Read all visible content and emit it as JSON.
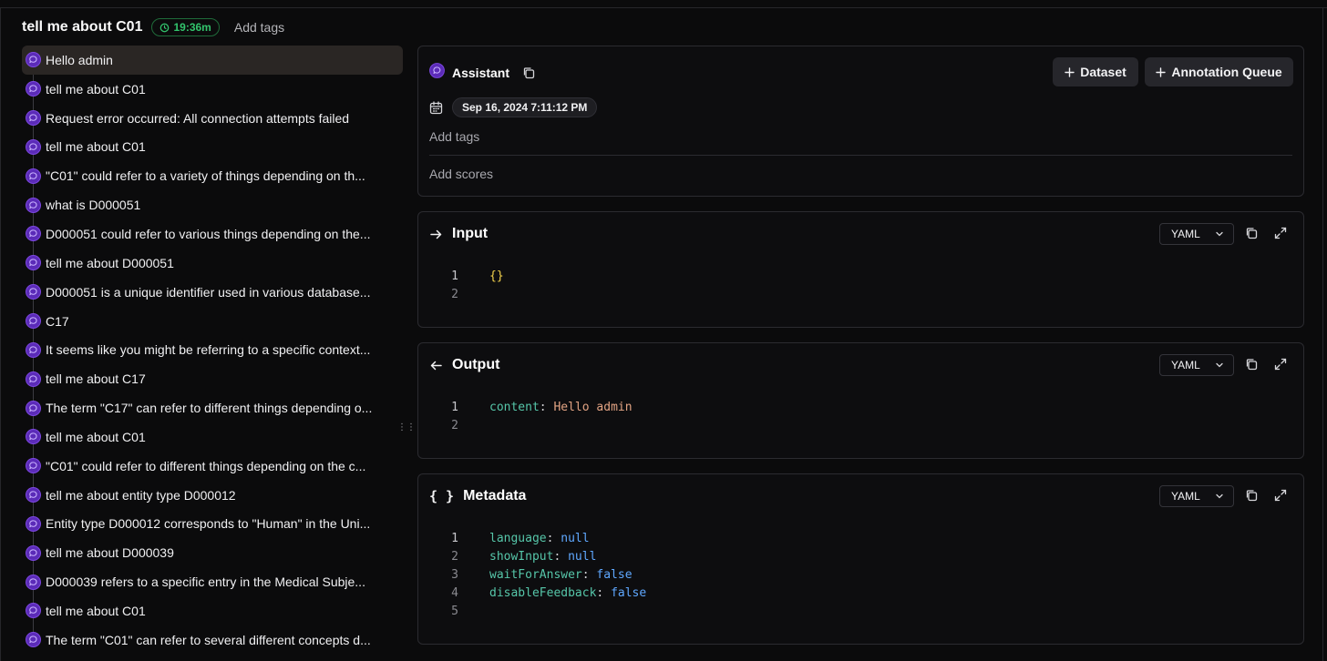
{
  "header": {
    "title": "tell me about C01",
    "timer": "19:36m",
    "add_tags": "Add tags"
  },
  "trace_list": [
    "Hello admin",
    "tell me about C01",
    "Request error occurred: All connection attempts failed",
    "tell me about C01",
    "\"C01\" could refer to a variety of things depending on th...",
    "what is D000051",
    "D000051 could refer to various things depending on the...",
    "tell me about D000051",
    "D000051 is a unique identifier used in various database...",
    "C17",
    "It seems like you might be referring to a specific context...",
    "tell me about C17",
    "The term \"C17\" can refer to different things depending o...",
    "tell me about C01",
    "\"C01\" could refer to different things depending on the c...",
    "tell me about entity type D000012",
    "Entity type D000012 corresponds to \"Human\" in the Uni...",
    "tell me about D000039",
    "D000039 refers to a specific entry in the Medical Subje...",
    "tell me about C01",
    "The term \"C01\" can refer to several different concepts d..."
  ],
  "detail": {
    "role": "Assistant",
    "dataset_button": "Dataset",
    "queue_button": "Annotation Queue",
    "date": "Sep 16, 2024 7:11:12 PM",
    "add_tags": "Add tags",
    "add_scores": "Add scores"
  },
  "input": {
    "title": "Input",
    "format": "YAML",
    "lines": [
      "1",
      "2"
    ],
    "code": "{}"
  },
  "output": {
    "title": "Output",
    "format": "YAML",
    "lines": [
      "1",
      "2"
    ],
    "key": "content",
    "value": "Hello admin"
  },
  "metadata": {
    "title": "Metadata",
    "format": "YAML",
    "lines": [
      "1",
      "2",
      "3",
      "4",
      "5"
    ],
    "entries": [
      {
        "key": "language",
        "value": "null"
      },
      {
        "key": "showInput",
        "value": "null"
      },
      {
        "key": "waitForAnswer",
        "value": "false"
      },
      {
        "key": "disableFeedback",
        "value": "false"
      }
    ]
  },
  "icons": {
    "timer": "clock-icon",
    "bubble": "chat-bubble-icon",
    "copy": "copy-icon",
    "calendar": "calendar-icon",
    "plus": "plus-icon",
    "input": "arrow-right-icon",
    "output": "arrow-left-icon",
    "metadata": "braces-icon",
    "expand": "expand-icon",
    "chevron": "chevron-down-icon",
    "drag": "drag-handle-icon"
  },
  "colors": {
    "accent_purple": "#5b2bb8",
    "timer_green": "#32c36c",
    "yaml_key": "#56c6a9",
    "yaml_string": "#e2a383",
    "yaml_keyword": "#5fa8ff",
    "yaml_brace": "#f2d14b"
  }
}
